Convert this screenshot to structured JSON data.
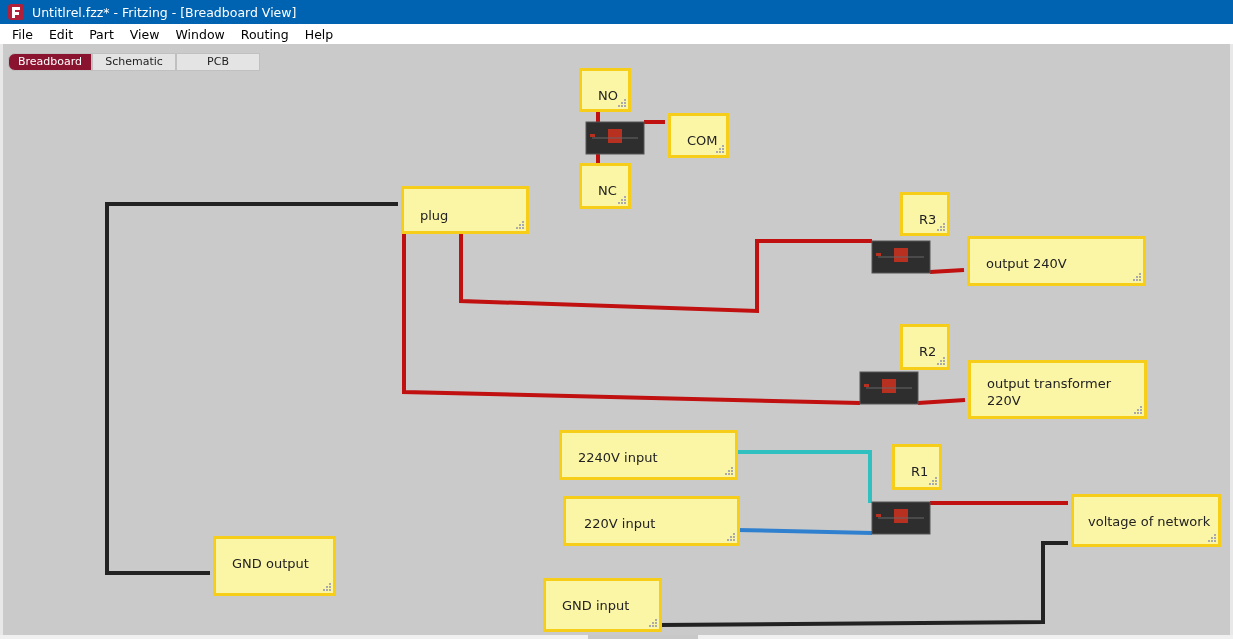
{
  "window": {
    "title": "Untitlrel.fzz* - Fritzing - [Breadboard View]"
  },
  "menu": [
    "File",
    "Edit",
    "Part",
    "View",
    "Window",
    "Routing",
    "Help"
  ],
  "tabs": [
    {
      "label": "Breadboard",
      "selected": true
    },
    {
      "label": "Schematic",
      "selected": false
    },
    {
      "label": "PCB",
      "selected": false
    }
  ],
  "notes": [
    {
      "text": "NO"
    },
    {
      "text": "COM"
    },
    {
      "text": "NC"
    },
    {
      "text": "plug"
    },
    {
      "text": "R3"
    },
    {
      "text": "output 240V"
    },
    {
      "text": "R2"
    },
    {
      "text": "output transformer 220V"
    },
    {
      "text": "2240V input"
    },
    {
      "text": "R1"
    },
    {
      "text": "220V input"
    },
    {
      "text": "voltage of network"
    },
    {
      "text": "GND output"
    },
    {
      "text": "GND input"
    }
  ]
}
